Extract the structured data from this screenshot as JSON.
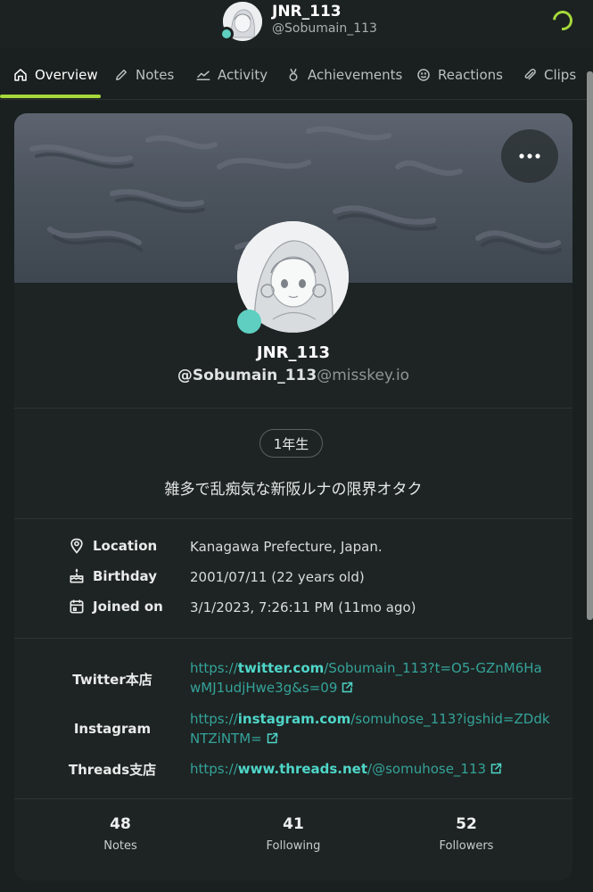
{
  "header": {
    "name": "JNR_113",
    "handle": "@Sobumain_113"
  },
  "tabs": [
    {
      "label": "Overview",
      "icon": "home-icon",
      "active": true
    },
    {
      "label": "Notes",
      "icon": "pencil-icon"
    },
    {
      "label": "Activity",
      "icon": "chart-icon"
    },
    {
      "label": "Achievements",
      "icon": "medal-icon"
    },
    {
      "label": "Reactions",
      "icon": "smile-icon"
    },
    {
      "label": "Clips",
      "icon": "paperclip-icon"
    }
  ],
  "profile": {
    "name": "JNR_113",
    "username": "@Sobumain_113",
    "host": "@misskey.io",
    "badge": "1年生",
    "bio": "雑多で乱痴気な新阪ルナの限界オタク"
  },
  "fields": [
    {
      "label": "Location",
      "icon": "map-pin-icon",
      "value": "Kanagawa Prefecture, Japan."
    },
    {
      "label": "Birthday",
      "icon": "cake-icon",
      "value": "2001/07/11 (22 years old)"
    },
    {
      "label": "Joined on",
      "icon": "calendar-icon",
      "value": "3/1/2023, 7:26:11 PM (11mo ago)"
    }
  ],
  "links": [
    {
      "label": "Twitter本店",
      "prefix": "https://",
      "host": "twitter.com",
      "rest": "/Sobumain_113?t=O5-GZnM6HawMJ1udjHwe3g&s=09"
    },
    {
      "label": "Instagram",
      "prefix": "https://",
      "host": "instagram.com",
      "rest": "/somuhose_113?igshid=ZDdkNTZiNTM="
    },
    {
      "label": "Threads支店",
      "prefix": "https://",
      "host": "www.threads.net",
      "rest": "/@somuhose_113"
    }
  ],
  "stats": [
    {
      "value": "48",
      "label": "Notes"
    },
    {
      "value": "41",
      "label": "Following"
    },
    {
      "value": "52",
      "label": "Followers"
    }
  ],
  "colors": {
    "accent": "#a6d83b",
    "online": "#5ecfc1",
    "link": "#4fd6c9"
  }
}
